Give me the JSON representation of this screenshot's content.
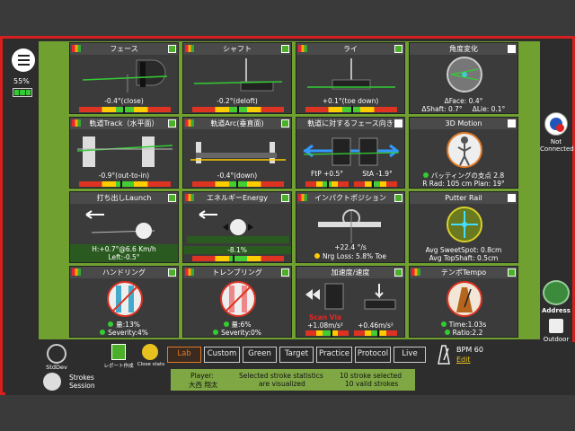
{
  "status": {
    "battery": "55%"
  },
  "panels": [
    {
      "title": "フェース",
      "value": "-0.4°(close)"
    },
    {
      "title": "シャフト",
      "value": "-0.2°(deloft)"
    },
    {
      "title": "ライ",
      "value": "+0.1°(toe down)"
    },
    {
      "title": "角度変化",
      "v1": "ΔFace: 0.4°",
      "v2a": "ΔShaft: 0.7°",
      "v2b": "ΔLie: 0.1°"
    },
    {
      "title": "軌道Track（水平面）",
      "value": "-0.9°(out-to-in)"
    },
    {
      "title": "軌道Arc(垂直面)",
      "value": "-0.4°(down)"
    },
    {
      "title": "軌道に対するフェース向き",
      "va": "FtP +0.5°",
      "vb": "StA -1.9°"
    },
    {
      "title": "3D Motion",
      "v1": "バッティングの支点 2.8",
      "v2": "R Rad: 105 cm    Plan: 19°"
    },
    {
      "title": "打ち出しLaunch",
      "v1": "H:+0.7°@6.6 Km/h",
      "v2": "Left:-0.5°"
    },
    {
      "title": "エネルギーEnergy",
      "value": "-8.1%"
    },
    {
      "title": "インパクトポジション",
      "v1": "+22.4 °/s",
      "v2": "Nrg Loss: 5.8% Toe"
    },
    {
      "title": "Putter Rail",
      "v1": "Avg SweetSpot: 0.8cm",
      "v2": "Avg TopShaft: 0.5cm"
    },
    {
      "title": "ハンドリング",
      "v1": "量:13%",
      "v2": "Severity:4%"
    },
    {
      "title": "トレンブリング",
      "v1": "量:6%",
      "v2": "Severity:0%"
    },
    {
      "title": "加速度/速度",
      "warn": "Scan Via",
      "va": "+1.08m/s²",
      "vb": "+0.46m/s²"
    },
    {
      "title": "テンポTempo",
      "v1": "Time:1.03s",
      "v2": "Ratio:2.2"
    }
  ],
  "right": {
    "conn": "Not Connected",
    "address": "Address",
    "outdoor": "Outdoor"
  },
  "bottom": {
    "stddev": "StdDev",
    "report": "レポート作成",
    "close_stats": "Close stats",
    "tabs": [
      "Lab",
      "Custom",
      "Green",
      "Target",
      "Practice",
      "Protocol",
      "Live"
    ],
    "bpm": "BPM 60",
    "edit": "Edit",
    "strokes": "Strokes\nSession",
    "player_label": "Player:",
    "player_name": "大西 翔太",
    "sel1": "Selected stroke statistics",
    "sel2": "are visualized",
    "cnt1": "10 stroke selected",
    "cnt2": "10 valid strokes"
  },
  "colors": {
    "accent": "#e07a28",
    "frame": "#d81e1e",
    "grid": "#6fa030"
  }
}
